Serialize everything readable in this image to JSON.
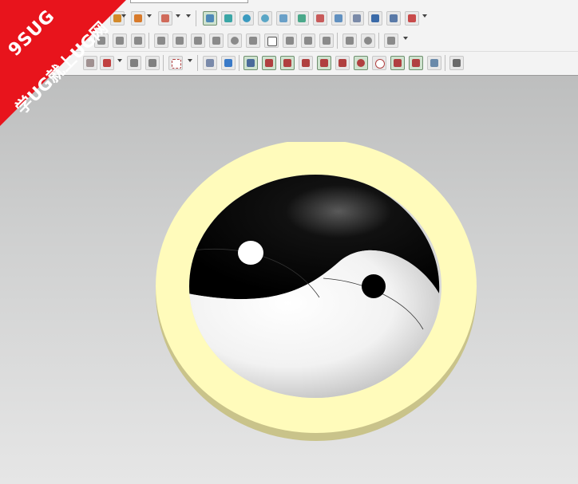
{
  "watermark": {
    "line1": "9SUG",
    "line2": "学UG就上UG网",
    "color": "#e8141c"
  },
  "toolbar": {
    "background": "#f3f3f3",
    "active_color": "#cfe3cf",
    "rows": [
      {
        "row": "row-1",
        "items": [
          {
            "name": "sketch-icon",
            "color": "#d38a2a"
          },
          {
            "name": "extrude-icon",
            "color": "#d87a2a"
          },
          {
            "name": "revolve-icon",
            "color": "#c97a3a"
          },
          {
            "name": "trim-body-icon",
            "color": "#d06a5a"
          },
          {
            "name": "feature-frame-icon",
            "color": "#4f8ab8"
          },
          {
            "name": "cylinder-feature-icon",
            "color": "#3aa6a6"
          },
          {
            "name": "sphere-feature-icon",
            "color": "#3a9abf"
          },
          {
            "name": "surface-feature-icon",
            "color": "#5aa6c6"
          },
          {
            "name": "pad-feature-icon",
            "color": "#6aa0c8"
          },
          {
            "name": "pattern-feature-icon",
            "color": "#4aa88a"
          },
          {
            "name": "draft-feature-icon",
            "color": "#c85a5a"
          },
          {
            "name": "offset-face-icon",
            "color": "#6090c0"
          },
          {
            "name": "grid-feature-icon",
            "color": "#7a8aa8"
          },
          {
            "name": "layout-feature-icon",
            "color": "#3a6aa8"
          },
          {
            "name": "rectangle-feature-icon",
            "color": "#c84a4a"
          }
        ]
      },
      {
        "row": "row-2",
        "items": [
          {
            "name": "horizontal-dimension-icon",
            "color": "#8a8a8a"
          },
          {
            "name": "vertical-dimension-icon",
            "color": "#8a8a8a"
          },
          {
            "name": "text-dimension-icon",
            "color": "#8a8a8a"
          },
          {
            "name": "grid-point-icon",
            "color": "#8a8a8a"
          },
          {
            "name": "triangle-icon",
            "color": "#8a8a8a"
          },
          {
            "name": "surface-grid-icon",
            "color": "#8a8a8a"
          },
          {
            "name": "arrow-icon",
            "color": "#8a8a8a"
          },
          {
            "name": "pie-chart-icon",
            "color": "#8a8a8a"
          },
          {
            "name": "xyz-icon",
            "color": "#8a8a8a"
          },
          {
            "name": "square-icon",
            "color": "#8a8a8a"
          },
          {
            "name": "scale-icon",
            "color": "#8a8a8a"
          },
          {
            "name": "note-icon",
            "color": "#8a8a8a"
          },
          {
            "name": "pencil-icon",
            "color": "#8a8a8a"
          },
          {
            "name": "measure-icon",
            "color": "#8a8a8a"
          },
          {
            "name": "settings-gear-icon",
            "color": "#8a8a8a"
          },
          {
            "name": "wave-icon",
            "color": "#8a8a8a"
          }
        ]
      },
      {
        "row": "row-3",
        "items": [
          {
            "name": "select-icon",
            "color": "#a09090"
          },
          {
            "name": "snap-icon",
            "color": "#c04040"
          },
          {
            "name": "move-icon",
            "color": "#808080"
          },
          {
            "name": "rotate-icon",
            "color": "#808080"
          },
          {
            "name": "box-select-icon",
            "color": "#808080"
          },
          {
            "name": "shaded-solid-icon",
            "color": "#7a8aaa"
          },
          {
            "name": "solid-blue-icon",
            "color": "#3a7ac8"
          },
          {
            "name": "point-snap-icon",
            "color": "#4a6a9a"
          },
          {
            "name": "line-icon",
            "color": "#b04040"
          },
          {
            "name": "slash-icon",
            "color": "#b04040"
          },
          {
            "name": "curve-icon",
            "color": "#b04040"
          },
          {
            "name": "polyline-icon",
            "color": "#b04040"
          },
          {
            "name": "arc-icon",
            "color": "#b04040"
          },
          {
            "name": "circle-center-icon",
            "color": "#b04040"
          },
          {
            "name": "circle-icon",
            "color": "#b04040"
          },
          {
            "name": "cross-icon",
            "color": "#b04040"
          },
          {
            "name": "tangent-line-icon",
            "color": "#b04040"
          },
          {
            "name": "wireframe-icon",
            "color": "#6a8aaa"
          },
          {
            "name": "grid-icon",
            "color": "#6a6a6a"
          }
        ]
      }
    ]
  },
  "viewport": {
    "background_top": "#bdbebe",
    "background_bottom": "#e6e6e6",
    "model": {
      "ring_color": "#fffbbb",
      "ring_edge_color": "#c9c38a",
      "dark_half_color": "#000000",
      "light_half_color": "#ffffff"
    }
  }
}
